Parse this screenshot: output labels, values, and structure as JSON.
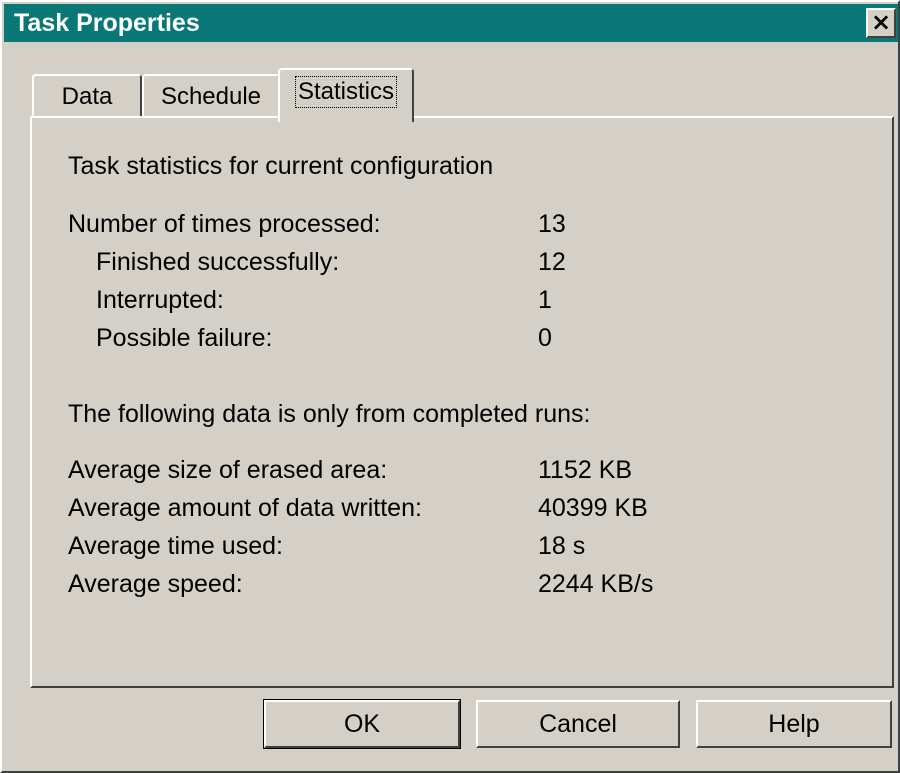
{
  "window": {
    "title": "Task Properties",
    "close_label": "×"
  },
  "tabs": [
    {
      "label": "Data",
      "active": false
    },
    {
      "label": "Schedule",
      "active": false
    },
    {
      "label": "Statistics",
      "active": true
    }
  ],
  "statistics": {
    "heading": "Task statistics for current configuration",
    "processed": {
      "label": "Number of times processed:",
      "value": "13"
    },
    "finished": {
      "label": "Finished successfully:",
      "value": "12"
    },
    "interrupted": {
      "label": "Interrupted:",
      "value": "1"
    },
    "failure": {
      "label": "Possible failure:",
      "value": "0"
    },
    "completed_heading": "The following data is only from completed runs:",
    "avg_erased": {
      "label": "Average size of erased area:",
      "value": "1152 KB"
    },
    "avg_written": {
      "label": "Average amount of data written:",
      "value": "40399 KB"
    },
    "avg_time": {
      "label": "Average time used:",
      "value": "18 s"
    },
    "avg_speed": {
      "label": "Average speed:",
      "value": "2244 KB/s"
    }
  },
  "buttons": {
    "ok": "OK",
    "cancel": "Cancel",
    "help": "Help"
  },
  "colors": {
    "titlebar": "#0a7777",
    "face": "#d4d0c8"
  }
}
